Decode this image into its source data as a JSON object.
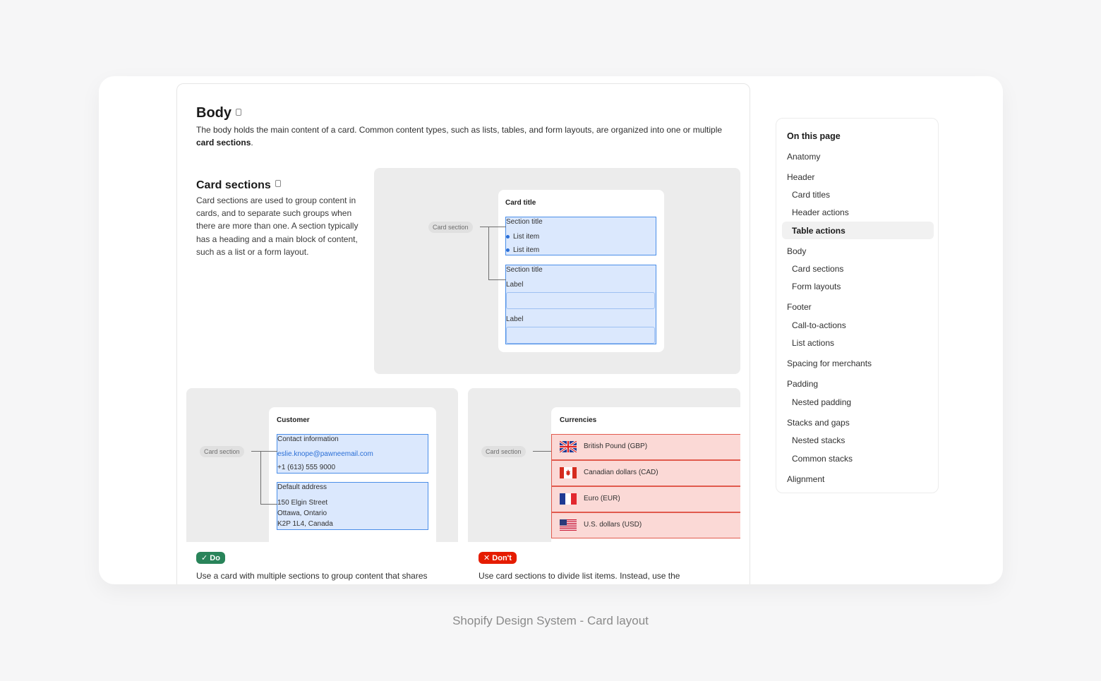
{
  "body_section": {
    "title": "Body",
    "desc_part1": "The body holds the main content of a card. Common content types, such as lists, tables, and form layouts, are organized into one or multiple ",
    "desc_bold": "card sections",
    "desc_end": "."
  },
  "card_sections": {
    "title": "Card sections",
    "desc": "Card sections are used to group content in cards, and to separate such groups when there are more than one. A section typically has a heading and a main block of content, such as a list or a form layout."
  },
  "anatomy_demo": {
    "card_title": "Card title",
    "pill": "Card section",
    "section1_title": "Section title",
    "list_items": [
      "List item",
      "List item"
    ],
    "section2_title": "Section title",
    "labels": [
      "Label",
      "Label"
    ]
  },
  "do_demo": {
    "pill": "Card section",
    "card_title": "Customer",
    "section1_title": "Contact information",
    "email": "eslie.knope@pawneemail.com",
    "phone": "+1 (613) 555 9000",
    "section2_title": "Default address",
    "address": [
      "150 Elgin Street",
      "Ottawa, Ontario",
      "K2P 1L4, Canada"
    ],
    "badge": "Do",
    "caption": "Use a card with multiple sections to group content that shares",
    "accent": "#29845a"
  },
  "dont_demo": {
    "pill": "Card section",
    "card_title": "Currencies",
    "currencies": [
      "British Pound (GBP)",
      "Canadian dollars (CAD)",
      "Euro (EUR)",
      "U.S. dollars (USD)"
    ],
    "badge": "Don't",
    "caption": "Use card sections to divide list items. Instead, use the",
    "accent": "#e51c00"
  },
  "toc": {
    "title": "On this page",
    "items": [
      {
        "label": "Anatomy"
      },
      {
        "label": "Header"
      },
      {
        "label": "Card titles"
      },
      {
        "label": "Header actions"
      },
      {
        "label": "Table actions",
        "active": true
      },
      {
        "label": "Body"
      },
      {
        "label": "Card sections"
      },
      {
        "label": "Form layouts"
      },
      {
        "label": "Footer"
      },
      {
        "label": "Call-to-actions"
      },
      {
        "label": "List actions"
      },
      {
        "label": "Spacing for merchants"
      },
      {
        "label": "Padding"
      },
      {
        "label": "Nested padding"
      },
      {
        "label": "Stacks and gaps"
      },
      {
        "label": "Nested stacks"
      },
      {
        "label": "Common stacks"
      },
      {
        "label": "Alignment"
      }
    ]
  },
  "caption": "Shopify Design System - Card layout"
}
